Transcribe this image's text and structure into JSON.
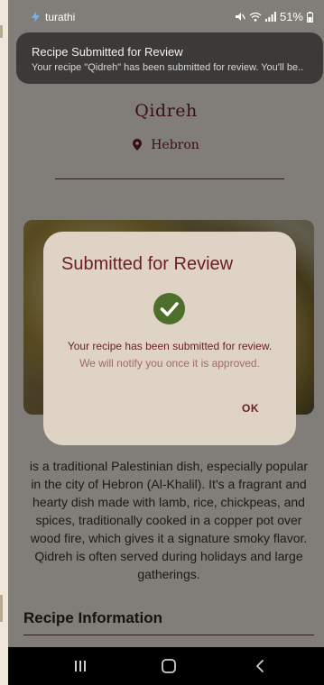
{
  "status_bar": {
    "app_label": "turathi",
    "battery": "51%",
    "icons": [
      "bolt-icon",
      "mute-icon",
      "wifi-icon",
      "signal-icon",
      "battery-icon"
    ]
  },
  "notification": {
    "title": "Recipe Submitted for Review",
    "body": "Your recipe \"Qidreh\" has been submitted for review. You'll be.."
  },
  "recipe": {
    "title": "Qidreh",
    "location": "Hebron",
    "description": "is a traditional Palestinian dish, especially popular in the city of Hebron (Al-Khalil). It's a fragrant and hearty dish made with lamb, rice, chickpeas, and spices, traditionally cooked in a copper pot over wood fire, which gives it a signature smoky flavor. Qidreh is often served during holidays and large gatherings.",
    "section_title": "Recipe Information"
  },
  "dialog": {
    "title": "Submitted for Review",
    "message": "Your recipe has been submitted for review.",
    "sub_message": "We will notify you once it is approved.",
    "ok_label": "OK"
  },
  "colors": {
    "accent": "#6b1d2a",
    "success": "#4e6e2c",
    "background": "#f3ede4",
    "dialog": "#ded3c5"
  },
  "nav_bar": {
    "icons": [
      "recents-icon",
      "home-icon",
      "back-icon"
    ]
  }
}
